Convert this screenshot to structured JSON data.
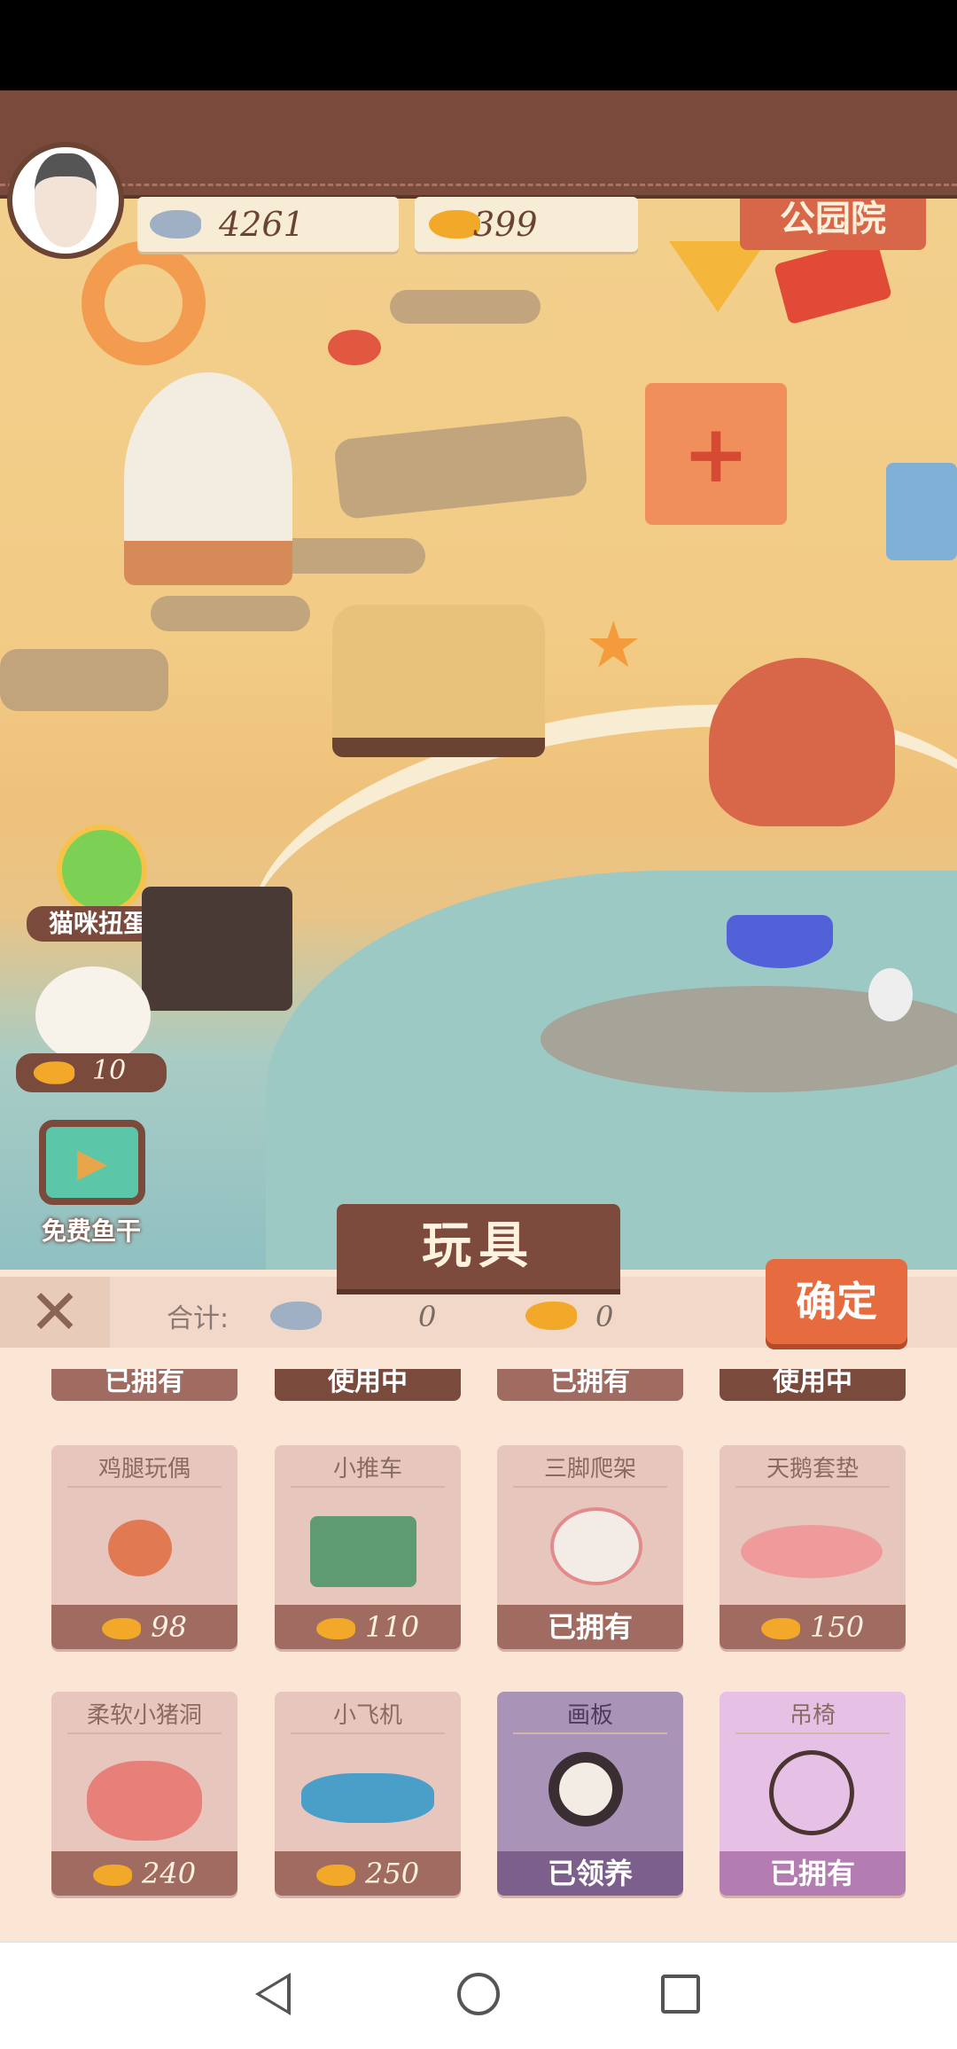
{
  "hud": {
    "gray_fish_count": "4261",
    "gold_fish_count": "399",
    "sign_text": "公园院"
  },
  "side": {
    "gacha_label": "猫咪扭蛋机",
    "cat_price": "10",
    "free_fish_label": "免费鱼干"
  },
  "panel": {
    "title": "玩具",
    "close_symbol": "✕",
    "total_label": "合计:",
    "total_gray": "0",
    "total_gold": "0",
    "confirm_label": "确定",
    "top_row_status": [
      "已拥有",
      "使用中",
      "已拥有",
      "使用中"
    ],
    "items": [
      {
        "name": "鸡腿玩偶",
        "price": "98",
        "status": ""
      },
      {
        "name": "小推车",
        "price": "110",
        "status": ""
      },
      {
        "name": "三脚爬架",
        "price": "",
        "status": "已拥有"
      },
      {
        "name": "天鹅套垫",
        "price": "150",
        "status": ""
      },
      {
        "name": "柔软小猪洞",
        "price": "240",
        "status": ""
      },
      {
        "name": "小飞机",
        "price": "250",
        "status": ""
      },
      {
        "name": "画板",
        "price": "",
        "status": "已领养"
      },
      {
        "name": "吊椅",
        "price": "",
        "status": "已拥有"
      }
    ]
  },
  "colors": {
    "leather": "#7a4a3c",
    "sand": "#f2cc86",
    "water": "#9cc9c4",
    "confirm": "#e66b3e",
    "panel": "#fbe6d6"
  }
}
